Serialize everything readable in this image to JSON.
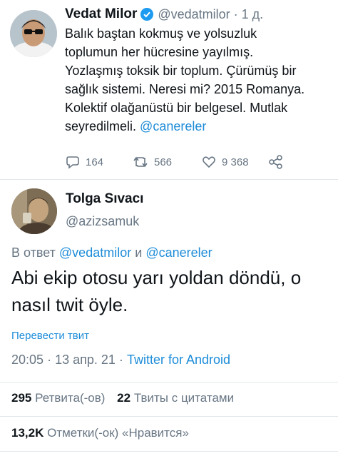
{
  "tweet1": {
    "author_name": "Vedat Milor",
    "handle": "@vedatmilor",
    "dot": "·",
    "time": "1 д.",
    "lines": [
      "Balık baştan kokmuş ve yolsuzluk",
      "toplumun her hücresine yayılmış.",
      "Yozlaşmış toksik bir toplum. Çürümüş bir",
      "sağlık sistemi. Neresi mi? 2015 Romanya.",
      "Kolektif olağanüstü bir belgesel. Mutlak"
    ],
    "last_line_text": "seyredilmeli.",
    "mention": "@canereler",
    "stats": {
      "replies": "164",
      "retweets": "566",
      "likes": "9 368"
    }
  },
  "tweet2": {
    "author_name": "Tolga Sıvacı",
    "handle": "@azizsamuk",
    "reply_prefix": "В ответ",
    "reply_user1": "@vedatmilor",
    "reply_and": "и",
    "reply_user2": "@canereler",
    "text_line1": "Abi ekip otosu yarı yoldan döndü, o",
    "text_line2": "nasıl twit öyle.",
    "translate": "Перевести твит",
    "time": "20:05",
    "date": "13 апр. 21",
    "sep": "·",
    "source": "Twitter for Android",
    "retweets_count": "295",
    "retweets_label": "Ретвита(-ов)",
    "quotes_count": "22",
    "quotes_label": "Твиты с цитатами",
    "likes_count": "13,2K",
    "likes_label": "Отметки(-ок) «Нравится»"
  },
  "colors": {
    "accent": "#1d8cd8",
    "muted": "#687684",
    "text": "#0f1419",
    "divider": "#e3e7ea"
  }
}
